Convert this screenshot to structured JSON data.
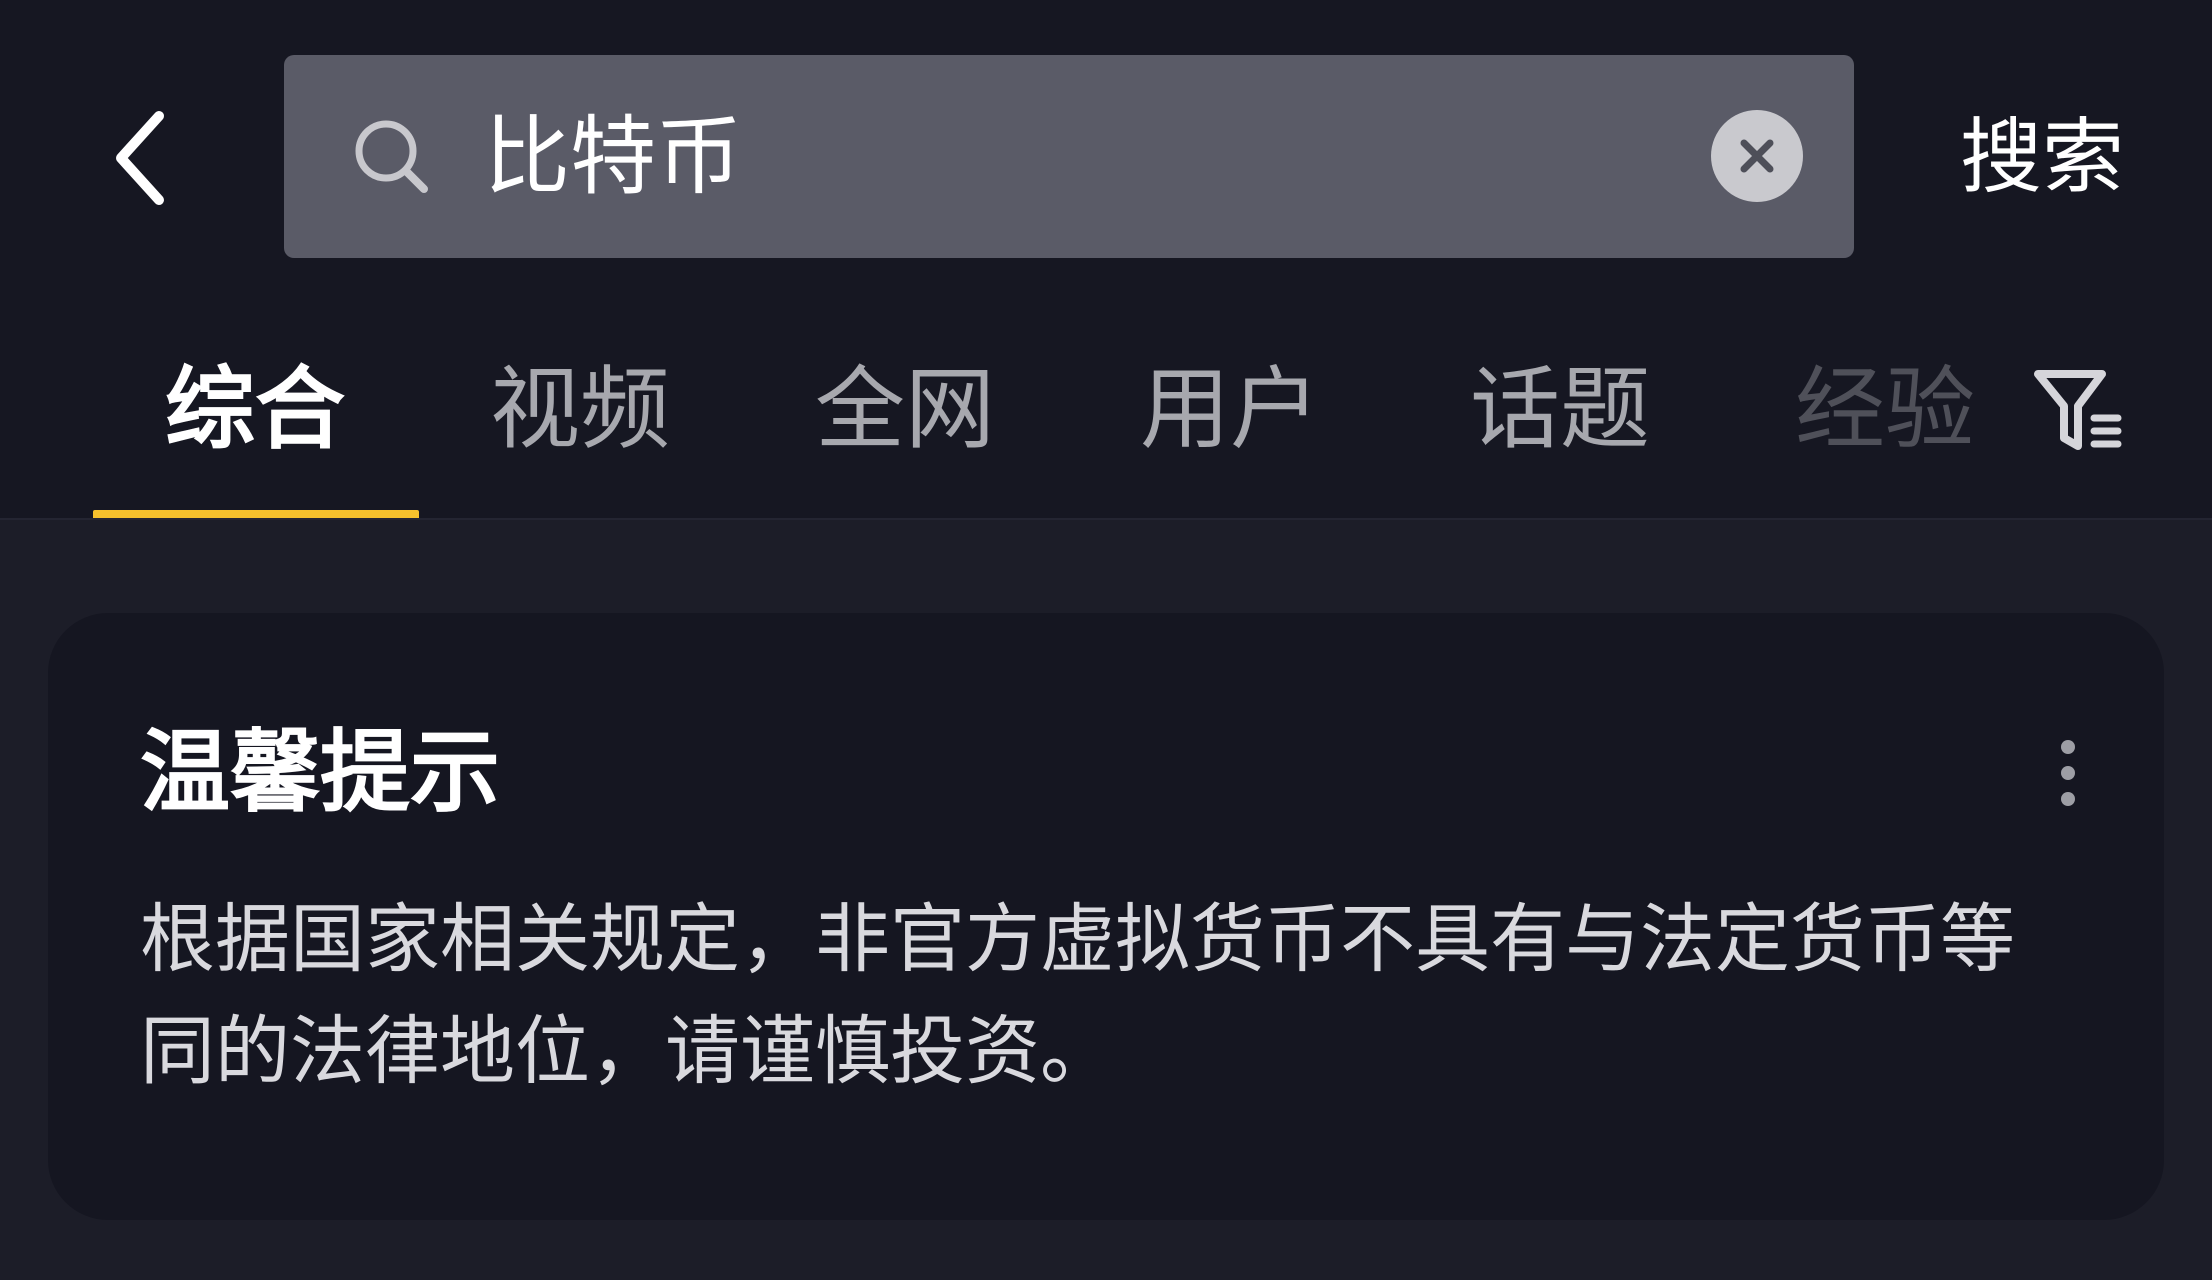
{
  "search": {
    "value": "比特币",
    "submit_label": "搜索"
  },
  "tabs": [
    {
      "label": "综合",
      "active": true
    },
    {
      "label": "视频",
      "active": false
    },
    {
      "label": "全网",
      "active": false
    },
    {
      "label": "用户",
      "active": false
    },
    {
      "label": "话题",
      "active": false
    },
    {
      "label": "经验",
      "active": false
    }
  ],
  "notice": {
    "title": "温馨提示",
    "body": "根据国家相关规定，非官方虚拟货币不具有与法定货币等同的法律地位，请谨慎投资。"
  },
  "icons": {
    "back": "chevron-left-icon",
    "search": "search-icon",
    "clear": "close-icon",
    "filter": "filter-icon",
    "more": "more-vertical-icon"
  },
  "colors": {
    "accent": "#f6c12d",
    "background": "#161722",
    "search_box": "#5a5b67"
  }
}
